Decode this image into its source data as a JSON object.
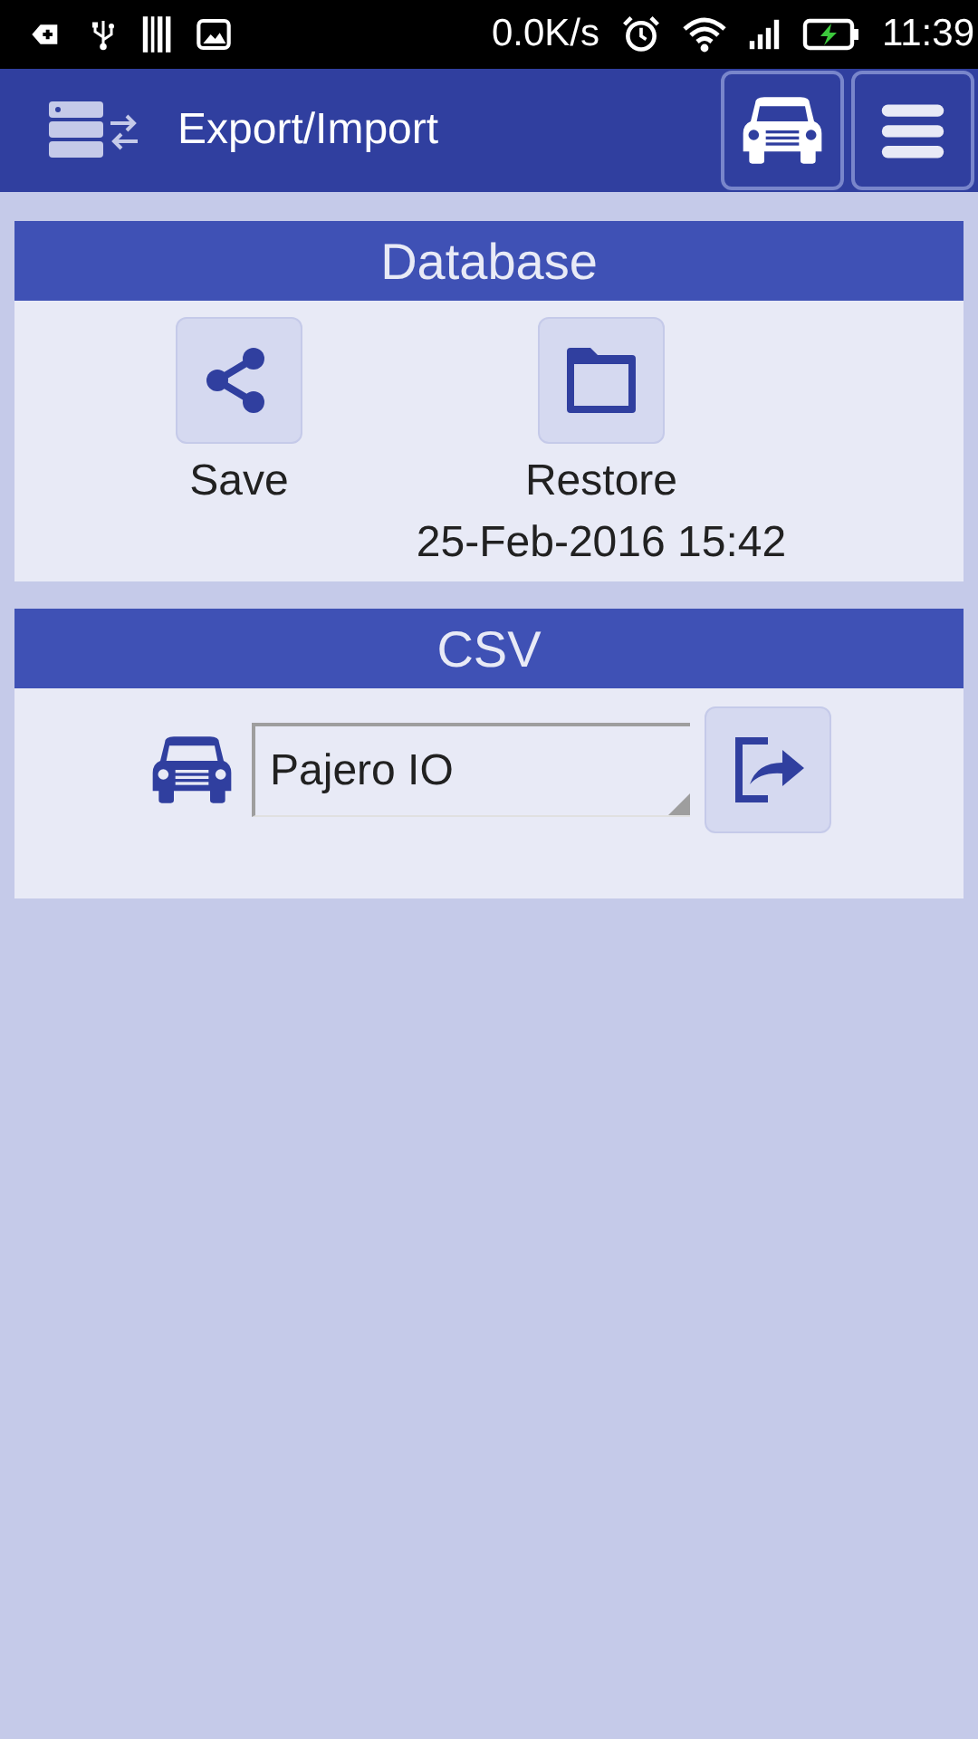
{
  "status_bar": {
    "network_speed": "0.0K/s",
    "time": "11:39"
  },
  "header": {
    "title": "Export/Import"
  },
  "sections": [
    {
      "kind": "database",
      "title": "Database",
      "actions": [
        {
          "kind": "share",
          "label": "Save"
        },
        {
          "kind": "folder",
          "label": "Restore",
          "detail": "25-Feb-2016 15:42"
        }
      ]
    },
    {
      "kind": "csv",
      "title": "CSV",
      "vehicle_select": {
        "value": "Pajero IO"
      }
    }
  ]
}
